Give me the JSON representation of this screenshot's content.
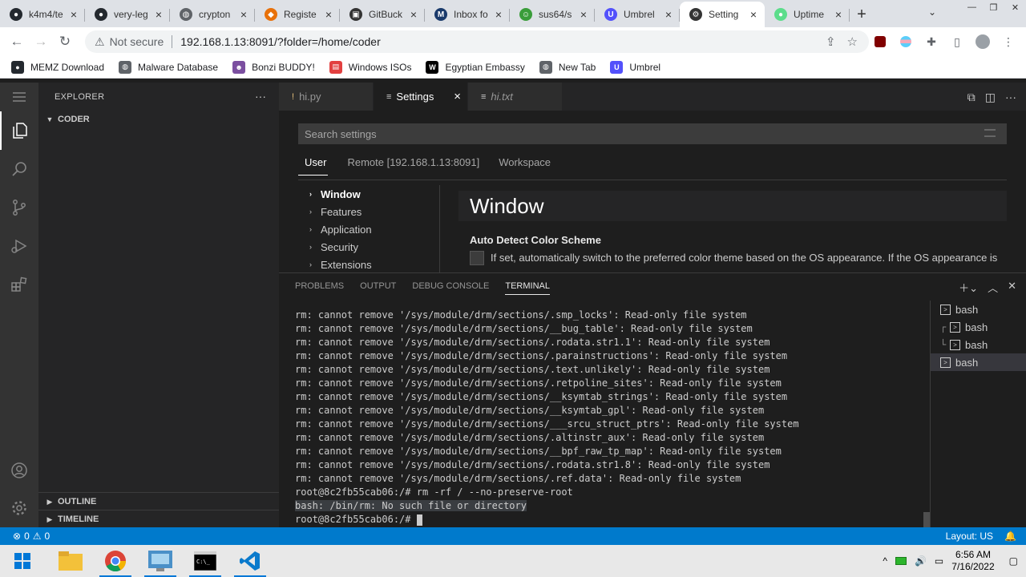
{
  "browser": {
    "tabs": [
      {
        "title": "k4m4/te",
        "icon": "github-icon",
        "color": "#24292f"
      },
      {
        "title": "very-leg",
        "icon": "github-icon",
        "color": "#24292f"
      },
      {
        "title": "crypton",
        "icon": "globe-icon",
        "color": "#5f6368"
      },
      {
        "title": "Registe",
        "icon": "diamond-icon",
        "color": "#e8710a"
      },
      {
        "title": "GitBuck",
        "icon": "gitbucket-icon",
        "color": "#333333"
      },
      {
        "title": "Inbox fo",
        "icon": "mail-icon",
        "color": "#1a3a6b"
      },
      {
        "title": "sus64/s",
        "icon": "mask-icon",
        "color": "#3a9d3a"
      },
      {
        "title": "Umbrel",
        "icon": "umbrel-icon",
        "color": "#5351fb"
      },
      {
        "title": "Setting",
        "icon": "settings-icon",
        "color": "#333333",
        "active": true
      },
      {
        "title": "Uptime",
        "icon": "dot-icon",
        "color": "#5cdd8b"
      }
    ],
    "url": "192.168.1.13:8091/?folder=/home/coder",
    "security_label": "Not secure",
    "bookmarks": [
      {
        "label": "MEMZ Download",
        "icon": "github-icon",
        "color": "#24292f"
      },
      {
        "label": "Malware Database",
        "icon": "globe-icon",
        "color": "#5f6368"
      },
      {
        "label": "Bonzi BUDDY!",
        "icon": "bonzi-icon",
        "color": "#7b4fa0"
      },
      {
        "label": "Windows ISOs",
        "icon": "rainbow-icon",
        "color": "#e24040"
      },
      {
        "label": "Egyptian Embassy",
        "icon": "wix-icon",
        "color": "#000000"
      },
      {
        "label": "New Tab",
        "icon": "globe-icon",
        "color": "#5f6368"
      },
      {
        "label": "Umbrel",
        "icon": "umbrel-icon",
        "color": "#5351fb"
      }
    ]
  },
  "sidebar": {
    "title": "EXPLORER",
    "root_folder": "CODER",
    "outline": "OUTLINE",
    "timeline": "TIMELINE"
  },
  "editor": {
    "tabs": [
      {
        "label": "hi.py",
        "icon": "python-file-icon"
      },
      {
        "label": "Settings",
        "icon": "settings-file-icon",
        "active": true
      },
      {
        "label": "hi.txt",
        "icon": "text-file-icon",
        "italic": true
      }
    ]
  },
  "settings": {
    "search_placeholder": "Search settings",
    "scopes": [
      "User",
      "Remote [192.168.1.13:8091]",
      "Workspace"
    ],
    "toc": [
      "Window",
      "Features",
      "Application",
      "Security",
      "Extensions"
    ],
    "section_title": "Window",
    "setting_label": "Auto Detect Color Scheme",
    "setting_desc": "If set, automatically switch to the preferred color theme based on the OS appearance. If the OS appearance is"
  },
  "panel": {
    "tabs": [
      "PROBLEMS",
      "OUTPUT",
      "DEBUG CONSOLE",
      "TERMINAL"
    ],
    "terminal_lines": [
      "rm: cannot remove '/sys/module/drm/sections/.smp_locks': Read-only file system",
      "rm: cannot remove '/sys/module/drm/sections/__bug_table': Read-only file system",
      "rm: cannot remove '/sys/module/drm/sections/.rodata.str1.1': Read-only file system",
      "rm: cannot remove '/sys/module/drm/sections/.parainstructions': Read-only file system",
      "rm: cannot remove '/sys/module/drm/sections/.text.unlikely': Read-only file system",
      "rm: cannot remove '/sys/module/drm/sections/.retpoline_sites': Read-only file system",
      "rm: cannot remove '/sys/module/drm/sections/__ksymtab_strings': Read-only file system",
      "rm: cannot remove '/sys/module/drm/sections/__ksymtab_gpl': Read-only file system",
      "rm: cannot remove '/sys/module/drm/sections/___srcu_struct_ptrs': Read-only file system",
      "rm: cannot remove '/sys/module/drm/sections/.altinstr_aux': Read-only file system",
      "rm: cannot remove '/sys/module/drm/sections/__bpf_raw_tp_map': Read-only file system",
      "rm: cannot remove '/sys/module/drm/sections/.rodata.str1.8': Read-only file system",
      "rm: cannot remove '/sys/module/drm/sections/.ref.data': Read-only file system",
      "root@8c2fb55cab06:/# rm -rf / --no-preserve-root",
      "bash: /bin/rm: No such file or directory",
      "root@8c2fb55cab06:/# "
    ],
    "terminals": [
      "bash",
      "bash",
      "bash",
      "bash"
    ]
  },
  "status": {
    "errors": "0",
    "warnings": "0",
    "layout": "Layout: US"
  },
  "taskbar": {
    "time": "6:56 AM",
    "date": "7/16/2022"
  }
}
